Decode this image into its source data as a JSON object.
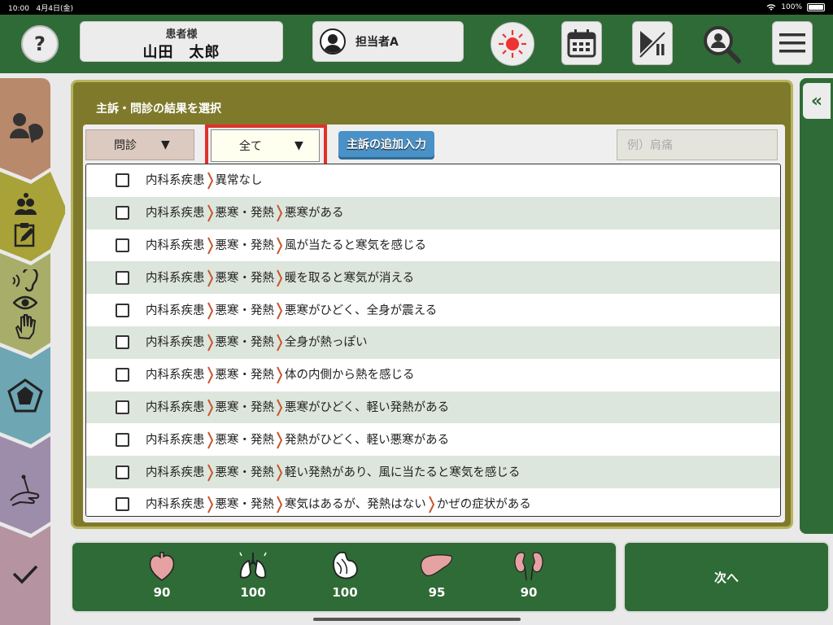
{
  "status_bar": {
    "time": "10:00",
    "date": "4月4日(金)",
    "battery": "100%"
  },
  "header": {
    "help_label": "?",
    "patient_label": "患者様",
    "patient_name": "山田　太郎",
    "staff_name": "担当者A",
    "buttons": [
      "alert-icon",
      "calendar-icon",
      "play-pause-icon",
      "search-person-icon",
      "menu-icon"
    ]
  },
  "left_nav": {
    "colors": [
      "#b8896a",
      "#a8a238",
      "#a8ae6a",
      "#6ea6b4",
      "#9e8cab",
      "#b593a0"
    ]
  },
  "main": {
    "title": "主訴・問診の結果を選択",
    "filter_type": "問診",
    "filter_scope": "全て",
    "dropdown_arrow": "▼",
    "add_button": "主訴の追加入力",
    "search_placeholder": "例）肩痛",
    "rows": [
      {
        "path": [
          "内科系疾患",
          "異常なし"
        ]
      },
      {
        "path": [
          "内科系疾患",
          "悪寒・発熱",
          "悪寒がある"
        ]
      },
      {
        "path": [
          "内科系疾患",
          "悪寒・発熱",
          "風が当たると寒気を感じる"
        ]
      },
      {
        "path": [
          "内科系疾患",
          "悪寒・発熱",
          "暖を取ると寒気が消える"
        ]
      },
      {
        "path": [
          "内科系疾患",
          "悪寒・発熱",
          "悪寒がひどく、全身が震える"
        ]
      },
      {
        "path": [
          "内科系疾患",
          "悪寒・発熱",
          "全身が熱っぽい"
        ]
      },
      {
        "path": [
          "内科系疾患",
          "悪寒・発熱",
          "体の内側から熱を感じる"
        ]
      },
      {
        "path": [
          "内科系疾患",
          "悪寒・発熱",
          "悪寒がひどく、軽い発熱がある"
        ]
      },
      {
        "path": [
          "内科系疾患",
          "悪寒・発熱",
          "発熱がひどく、軽い悪寒がある"
        ]
      },
      {
        "path": [
          "内科系疾患",
          "悪寒・発熱",
          "軽い発熱があり、風に当たると寒気を感じる"
        ]
      },
      {
        "path": [
          "内科系疾患",
          "悪寒・発熱",
          "寒気はあるが、発熱はない",
          "かぜの症状がある"
        ]
      }
    ]
  },
  "right_panel": {
    "collapse_label": "«"
  },
  "organs": [
    {
      "icon": "heart-icon",
      "value": "90"
    },
    {
      "icon": "lungs-icon",
      "value": "100"
    },
    {
      "icon": "stomach-icon",
      "value": "100"
    },
    {
      "icon": "liver-icon",
      "value": "95"
    },
    {
      "icon": "kidneys-icon",
      "value": "90"
    }
  ],
  "next_button": "次へ",
  "colors": {
    "header_green": "#2f6b36",
    "panel_olive": "#7f7a2b",
    "highlight_red": "#e0312a",
    "separator": "#c8552e"
  }
}
